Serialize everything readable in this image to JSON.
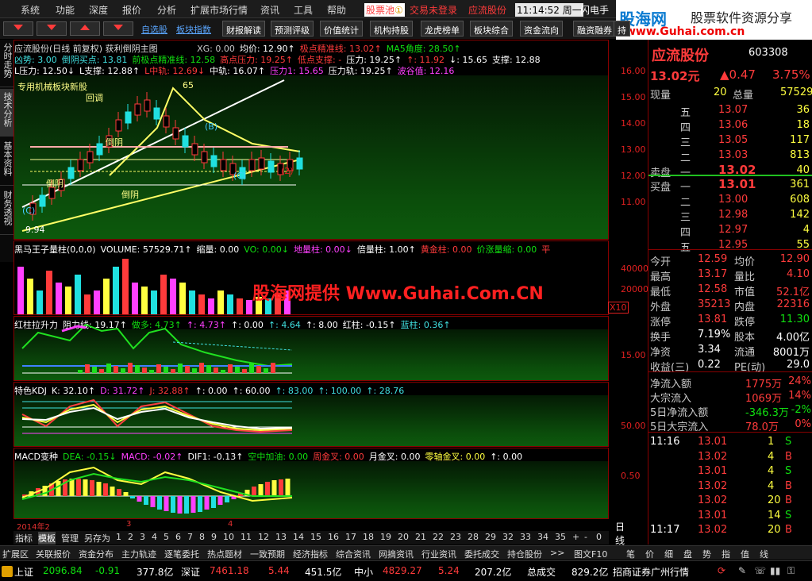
{
  "menu": {
    "items": [
      "系统",
      "功能",
      "深度",
      "报价",
      "分析",
      "扩展市场行情",
      "资讯",
      "工具",
      "帮助"
    ],
    "stock_pool": "股票池",
    "stock_pool_badge": "①",
    "trade_login": "交易未登录",
    "stock_name_top": "应流股份",
    "clock": "11:14:52 周一",
    "flash": "闪电手",
    "trade": "行情"
  },
  "logo": {
    "brand": "股海网",
    "tagline": "股票软件资源分享",
    "url": "www.Guhai.com.cn"
  },
  "toolbar": {
    "labels": [
      "自选股",
      "板块指数"
    ],
    "buttons": [
      "财报解读",
      "预测评级",
      "价值统计",
      "机构持股",
      "龙虎榜单",
      "板块综合",
      "资金流向",
      "融资融券",
      "持"
    ]
  },
  "left_tabs": [
    "分时走势",
    "技术分析",
    "基本资料",
    "财务透视"
  ],
  "main_chart": {
    "title": "应流股份(日线 前复权) 获利倒阴主图",
    "line1": [
      {
        "t": "XG: 0.00",
        "c": "gry"
      },
      {
        "t": "均价: 12.90↑",
        "c": "wht"
      },
      {
        "t": "极点精准线: 13.02↑",
        "c": "red"
      },
      {
        "t": "MA5角度: 28.50↑",
        "c": "grn"
      }
    ],
    "line2": [
      {
        "t": "凶势: 3.00",
        "c": "cyn"
      },
      {
        "t": "倒阴买点: 13.81",
        "c": "cyn"
      },
      {
        "t": "前极点精准线: 12.58",
        "c": "grn"
      },
      {
        "t": "高点压力: 19.25↑",
        "c": "red"
      },
      {
        "t": "低点支撑: -",
        "c": "red"
      },
      {
        "t": "压力: 19.25↑",
        "c": "wht"
      },
      {
        "t": "↑: 11.92",
        "c": "red"
      },
      {
        "t": "↓: 15.65",
        "c": "wht"
      },
      {
        "t": "支撑: 12.88",
        "c": "wht"
      }
    ],
    "line3": [
      {
        "t": "L压力: 12.50↓",
        "c": "wht"
      },
      {
        "t": "L支撑: 12.88↑",
        "c": "wht"
      },
      {
        "t": "L中轨: 12.69↓",
        "c": "red"
      },
      {
        "t": "中轨: 16.07↑",
        "c": "wht"
      },
      {
        "t": "压力1: 15.65",
        "c": "mag"
      },
      {
        "t": "压力轨: 19.25↑",
        "c": "wht"
      },
      {
        "t": "波谷值: 12.16",
        "c": "mag"
      }
    ],
    "notes": [
      "专用机械板块新股",
      "回调",
      "倒阴",
      "倒阴",
      "倒阴",
      "(B)",
      "(C)",
      "(C)",
      "(2)",
      "9.94",
      "65"
    ],
    "yaxis": [
      "16.00",
      "15.00",
      "14.00",
      "13.00",
      "12.00",
      "11.00"
    ]
  },
  "volume_panel": {
    "title": "黑马王子量柱(0,0,0)",
    "items": [
      {
        "t": "VOLUME: 57529.71↑",
        "c": "wht"
      },
      {
        "t": "缩量: 0.00",
        "c": "wht"
      },
      {
        "t": "VO: 0.00↓",
        "c": "grn"
      },
      {
        "t": "地量柱: 0.00↓",
        "c": "mag"
      },
      {
        "t": "倍量柱: 1.00↑",
        "c": "wht"
      },
      {
        "t": "黄金柱: 0.00",
        "c": "red"
      },
      {
        "t": "价涨量缩: 0.00",
        "c": "grn"
      },
      {
        "t": "平",
        "c": "red"
      }
    ],
    "yaxis": [
      "40000",
      "20000"
    ],
    "unit": "X10",
    "watermark": "股海网提供 Www.Guhai.Com.CN"
  },
  "hzl_panel": {
    "title": "红柱拉升力",
    "items": [
      {
        "t": "阻力线: 19.17↑",
        "c": "wht"
      },
      {
        "t": "做多: 4.73↑",
        "c": "grn"
      },
      {
        "t": "↑: 4.73↑",
        "c": "mag"
      },
      {
        "t": "↑: 0.00",
        "c": "wht"
      },
      {
        "t": "↑: 4.64",
        "c": "cyn"
      },
      {
        "t": "↑: 8.00",
        "c": "wht"
      },
      {
        "t": "红柱: -0.15↑",
        "c": "wht"
      },
      {
        "t": "蓝柱: 0.36↑",
        "c": "cyn"
      }
    ],
    "yaxis": [
      "15.00"
    ]
  },
  "kdj_panel": {
    "title": "特色KDJ",
    "items": [
      {
        "t": "K: 32.10↑",
        "c": "wht"
      },
      {
        "t": "D: 31.72↑",
        "c": "mag"
      },
      {
        "t": "J: 32.88↑",
        "c": "red"
      },
      {
        "t": "↑: 0.00",
        "c": "wht"
      },
      {
        "t": "↑: 60.00",
        "c": "wht"
      },
      {
        "t": "↑: 83.00",
        "c": "cyn"
      },
      {
        "t": "↑: 100.00",
        "c": "cyn"
      },
      {
        "t": "↑: 28.76",
        "c": "cyn"
      }
    ],
    "yaxis": [
      "50.00"
    ]
  },
  "macd_panel": {
    "title": "MACD变种",
    "items": [
      {
        "t": "DEA: -0.15↓",
        "c": "grn"
      },
      {
        "t": "MACD: -0.02↑",
        "c": "mag"
      },
      {
        "t": "DIF1: -0.13↑",
        "c": "wht"
      },
      {
        "t": "空中加油: 0.00",
        "c": "grn"
      },
      {
        "t": "周金叉: 0.00",
        "c": "red"
      },
      {
        "t": "月金叉: 0.00",
        "c": "wht"
      },
      {
        "t": "零轴金叉: 0.00",
        "c": "yel"
      },
      {
        "t": "↑: 0.00",
        "c": "wht"
      }
    ],
    "yaxis": [
      "0.50"
    ]
  },
  "xaxis": {
    "labels": [
      "2014年2",
      "3",
      "4"
    ],
    "period": "日线"
  },
  "bottom_tabs": {
    "items": [
      "指标",
      "模板",
      "管理",
      "另存为",
      "1",
      "2",
      "3",
      "4",
      "5",
      "6",
      "7",
      "8",
      "9",
      "10",
      "11",
      "12",
      "13",
      "14",
      "15",
      "16",
      "17",
      "18",
      "19",
      "20",
      "21",
      "22",
      "23",
      "28",
      "29",
      "32",
      "33",
      "34",
      "35",
      "+",
      "-",
      "0"
    ]
  },
  "funcbar": {
    "items": [
      "扩展区",
      "关联报价",
      "资金分布",
      "主力轨迹",
      "逐笔委托",
      "热点题材",
      "一致预期",
      "经济指标",
      "综合资讯",
      "网摘资讯",
      "行业资讯",
      "委托成交",
      "持仓股份",
      ">>",
      "图文F10",
      "笔",
      "价",
      "细",
      "盘",
      "势",
      "指",
      "值",
      "线"
    ]
  },
  "status": {
    "sh_label": "上证",
    "sh_val": "2096.84",
    "sh_chg": "-0.91",
    "sh_amt": "377.8亿",
    "sz_label": "深证",
    "sz_val": "7461.18",
    "sz_chg": "5.44",
    "sz_amt": "451.5亿",
    "zx_label": "中小",
    "zx_val": "4829.27",
    "zx_chg": "5.24",
    "zx_amt": "207.2亿",
    "total_label": "总成交",
    "total_amt": "829.2亿",
    "broker": "招商证券广州行情"
  },
  "quote": {
    "name": "应流股份",
    "code": "603308",
    "price": "13.02元",
    "change": "▲0.47",
    "pct": "3.75%",
    "now_label": "现量",
    "now_val": "20",
    "total_label": "总量",
    "total_val": "57529",
    "sell_label": "卖盘",
    "buy_label": "买盘",
    "asks": [
      {
        "l": "五",
        "p": "13.07",
        "v": "36"
      },
      {
        "l": "四",
        "p": "13.06",
        "v": "18"
      },
      {
        "l": "三",
        "p": "13.05",
        "v": "117"
      },
      {
        "l": "二",
        "p": "13.03",
        "v": "813"
      },
      {
        "l": "一",
        "p": "13.02",
        "v": "40"
      }
    ],
    "bids": [
      {
        "l": "一",
        "p": "13.01",
        "v": "361"
      },
      {
        "l": "二",
        "p": "13.00",
        "v": "608"
      },
      {
        "l": "三",
        "p": "12.98",
        "v": "142"
      },
      {
        "l": "四",
        "p": "12.97",
        "v": "4"
      },
      {
        "l": "五",
        "p": "12.95",
        "v": "55"
      }
    ],
    "stats": [
      [
        "今开",
        "12.59",
        "均价",
        "12.90"
      ],
      [
        "最高",
        "13.17",
        "量比",
        "4.10"
      ],
      [
        "最低",
        "12.58",
        "市值",
        "52.1亿"
      ],
      [
        "外盘",
        "35213",
        "内盘",
        "22316"
      ],
      [
        "涨停",
        "13.81",
        "跌停",
        "11.30"
      ],
      [
        "换手",
        "7.19%",
        "股本",
        "4.00亿"
      ],
      [
        "净资",
        "3.34",
        "流通",
        "8001万"
      ],
      [
        "收益(三)",
        "0.22",
        "PE(动)",
        "29.0"
      ]
    ],
    "flows": [
      [
        "净流入额",
        "1775万",
        "24%"
      ],
      [
        "大宗流入",
        "1069万",
        "14%"
      ],
      [
        "5日净流入额",
        "-346.3万",
        "-2%"
      ],
      [
        "5日大宗流入",
        "78.0万",
        "0%"
      ]
    ],
    "ticks": [
      [
        "11:16",
        "13.01",
        "1",
        "S"
      ],
      [
        "",
        "13.02",
        "4",
        "B"
      ],
      [
        "",
        "13.01",
        "4",
        "S"
      ],
      [
        "",
        "13.02",
        "4",
        "B"
      ],
      [
        "",
        "13.02",
        "20",
        "B"
      ],
      [
        "",
        "13.01",
        "14",
        "S"
      ],
      [
        "11:17",
        "13.02",
        "20",
        "B"
      ]
    ]
  }
}
